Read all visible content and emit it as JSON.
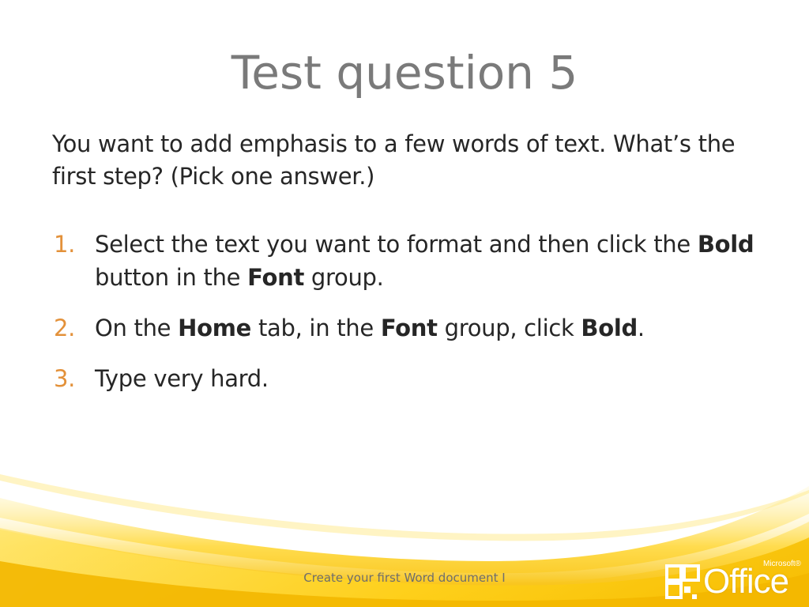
{
  "slide": {
    "title": "Test question 5",
    "question": "You want to add emphasis to a few words of text. What’s the first step? (Pick one answer.)",
    "answers": [
      {
        "number": "1.",
        "parts": [
          "Select the text you want to format and then click the ",
          "Bold",
          " button in the ",
          "Font",
          " group."
        ]
      },
      {
        "number": "2.",
        "parts": [
          "On the ",
          "Home",
          " tab, in the ",
          "Font",
          " group, click ",
          "Bold",
          "."
        ]
      },
      {
        "number": "3.",
        "parts": [
          "Type very hard."
        ]
      }
    ],
    "footer": "Create your first Word document I",
    "logo": {
      "word": "Office",
      "brand": "Microsoft®",
      "icon": "office-logo-icon"
    }
  },
  "colors": {
    "title": "#7a7a7a",
    "body_text": "#262626",
    "number_accent": "#e3913a",
    "swoosh_yellow": "#f6c400"
  }
}
